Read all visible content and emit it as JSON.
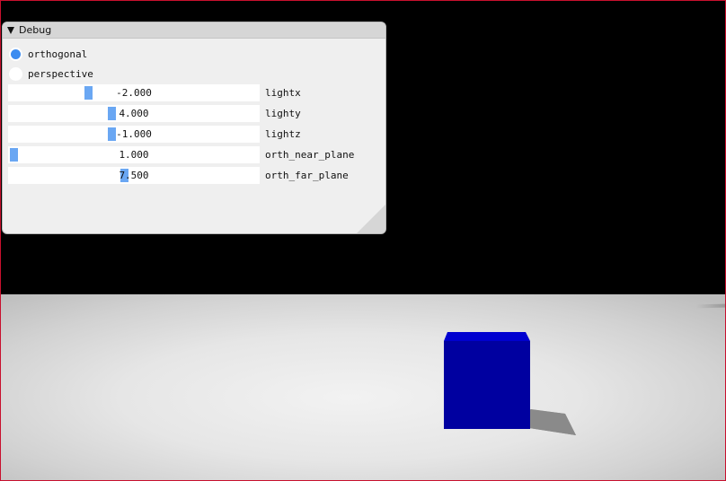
{
  "debug_window": {
    "title": "Debug",
    "radio_options": [
      {
        "label": "orthogonal",
        "selected": true
      },
      {
        "label": "perspective",
        "selected": false
      }
    ],
    "sliders": [
      {
        "label": "lightx",
        "value_text": "-2.000",
        "fraction": 0.31
      },
      {
        "label": "lighty",
        "value_text": "4.000",
        "fraction": 0.41
      },
      {
        "label": "lightz",
        "value_text": "-1.000",
        "fraction": 0.41
      },
      {
        "label": "orth_near_plane",
        "value_text": "1.000",
        "fraction": 0.0
      },
      {
        "label": "orth_far_plane",
        "value_text": "7.500",
        "fraction": 0.46
      }
    ]
  },
  "scene": {
    "background_color": "#000000",
    "floor_color": "#e6e6e6",
    "cube_color": "#0000a0",
    "cube_top_color": "#0000d0",
    "shadow_color": "#8a8a8a"
  },
  "colors": {
    "accent": "#3c8cf0",
    "slider_grab": "#6aa7f3",
    "window_bg": "#efefef",
    "title_bg": "#d6d6d6",
    "border": "#c8102e"
  }
}
